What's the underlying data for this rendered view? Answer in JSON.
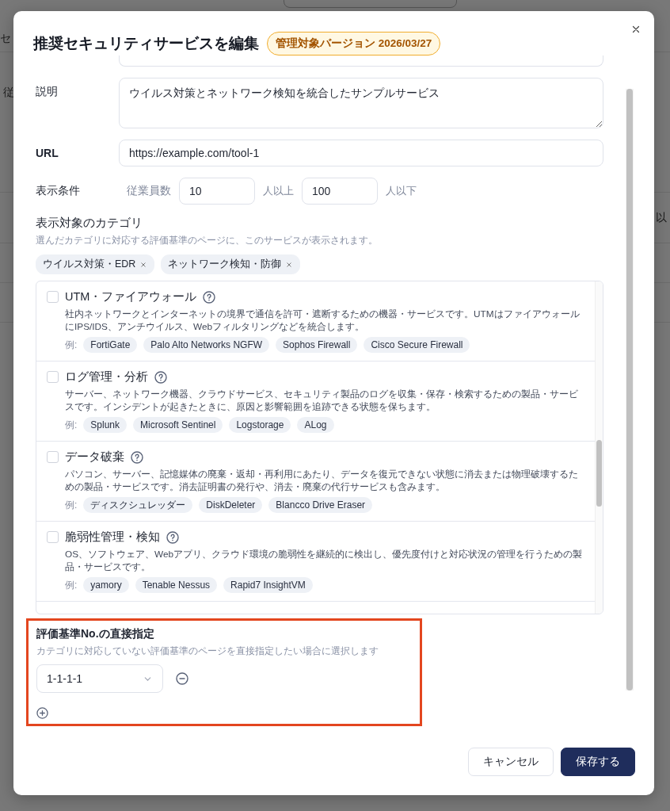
{
  "background_page": {
    "texts": [
      "セ",
      "従",
      "以"
    ]
  },
  "dialog": {
    "title": "推奨セキュリティサービスを編集",
    "version_badge": "管理対象バージョン 2026/03/27",
    "fields": [
      {
        "kind": "textarea",
        "label": "説明",
        "value": "ウイルス対策とネットワーク検知を統合したサンプルサービス"
      },
      {
        "kind": "input",
        "label": "URL",
        "value": "https://example.com/tool-1"
      }
    ],
    "display_condition": {
      "label": "表示条件",
      "prefix": "従業員数",
      "min_value": "10",
      "min_suffix": "人以上",
      "max_value": "100",
      "max_suffix": "人以下"
    },
    "categories": {
      "label": "表示対象のカテゴリ",
      "help": "選んだカテゴリに対応する評価基準のページに、このサービスが表示されます。",
      "selected_chips": [
        "ウイルス対策・EDR",
        "ネットワーク検知・防御"
      ],
      "items": [
        {
          "name": "UTM・ファイアウォール",
          "checked": false,
          "example_label": "例:",
          "description": "社内ネットワークとインターネットの境界で通信を許可・遮断するための機器・サービスです。UTMはファイアウォールにIPS/IDS、アンチウイルス、Webフィルタリングなどを統合します。",
          "examples": [
            "FortiGate",
            "Palo Alto Networks NGFW",
            "Sophos Firewall",
            "Cisco Secure Firewall"
          ]
        },
        {
          "name": "ログ管理・分析",
          "checked": false,
          "example_label": "例:",
          "description": "サーバー、ネットワーク機器、クラウドサービス、セキュリティ製品のログを収集・保存・検索するための製品・サービスです。インシデントが起きたときに、原因と影響範囲を追跡できる状態を保ちます。",
          "examples": [
            "Splunk",
            "Microsoft Sentinel",
            "Logstorage",
            "ALog"
          ]
        },
        {
          "name": "データ破棄",
          "checked": false,
          "example_label": "例:",
          "description": "パソコン、サーバー、記憶媒体の廃棄・返却・再利用にあたり、データを復元できない状態に消去または物理破壊するための製品・サービスです。消去証明書の発行や、消去・廃棄の代行サービスも含みます。",
          "examples": [
            "ディスクシュレッダー",
            "DiskDeleter",
            "Blancco Drive Eraser"
          ]
        },
        {
          "name": "脆弱性管理・検知",
          "checked": false,
          "example_label": "例:",
          "description": "OS、ソフトウェア、Webアプリ、クラウド環境の脆弱性を継続的に検出し、優先度付けと対応状況の管理を行うための製品・サービスです。",
          "examples": [
            "yamory",
            "Tenable Nessus",
            "Rapid7 InsightVM"
          ]
        }
      ]
    },
    "direct_criteria": {
      "label": "評価基準No.の直接指定",
      "help": "カテゴリに対応していない評価基準のページを直接指定したい場合に選択します",
      "selects": [
        "1-1-1-1"
      ]
    },
    "buttons": {
      "cancel": "キャンセル",
      "save": "保存する"
    }
  }
}
